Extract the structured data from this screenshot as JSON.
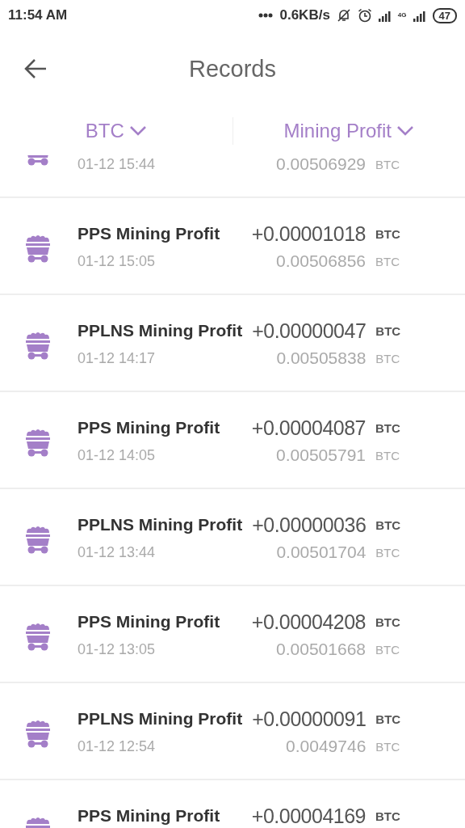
{
  "status_bar": {
    "time": "11:54 AM",
    "speed": "0.6KB/s",
    "network": "4G",
    "battery": "47"
  },
  "header": {
    "title": "Records"
  },
  "filters": [
    {
      "label": "BTC"
    },
    {
      "label": "Mining Profit"
    }
  ],
  "records": [
    {
      "date": "01-12 15:44",
      "balance": "0.00506929",
      "balance_unit": "BTC"
    },
    {
      "title": "PPS Mining Profit",
      "amount": "+0.00001018",
      "amount_unit": "BTC",
      "date": "01-12 15:05",
      "balance": "0.00506856",
      "balance_unit": "BTC"
    },
    {
      "title": "PPLNS Mining Profit",
      "amount": "+0.00000047",
      "amount_unit": "BTC",
      "date": "01-12 14:17",
      "balance": "0.00505838",
      "balance_unit": "BTC"
    },
    {
      "title": "PPS Mining Profit",
      "amount": "+0.00004087",
      "amount_unit": "BTC",
      "date": "01-12 14:05",
      "balance": "0.00505791",
      "balance_unit": "BTC"
    },
    {
      "title": "PPLNS Mining Profit",
      "amount": "+0.00000036",
      "amount_unit": "BTC",
      "date": "01-12 13:44",
      "balance": "0.00501704",
      "balance_unit": "BTC"
    },
    {
      "title": "PPS Mining Profit",
      "amount": "+0.00004208",
      "amount_unit": "BTC",
      "date": "01-12 13:05",
      "balance": "0.00501668",
      "balance_unit": "BTC"
    },
    {
      "title": "PPLNS Mining Profit",
      "amount": "+0.00000091",
      "amount_unit": "BTC",
      "date": "01-12 12:54",
      "balance": "0.0049746",
      "balance_unit": "BTC"
    },
    {
      "title": "PPS Mining Profit",
      "amount": "+0.00004169",
      "amount_unit": "BTC"
    }
  ]
}
